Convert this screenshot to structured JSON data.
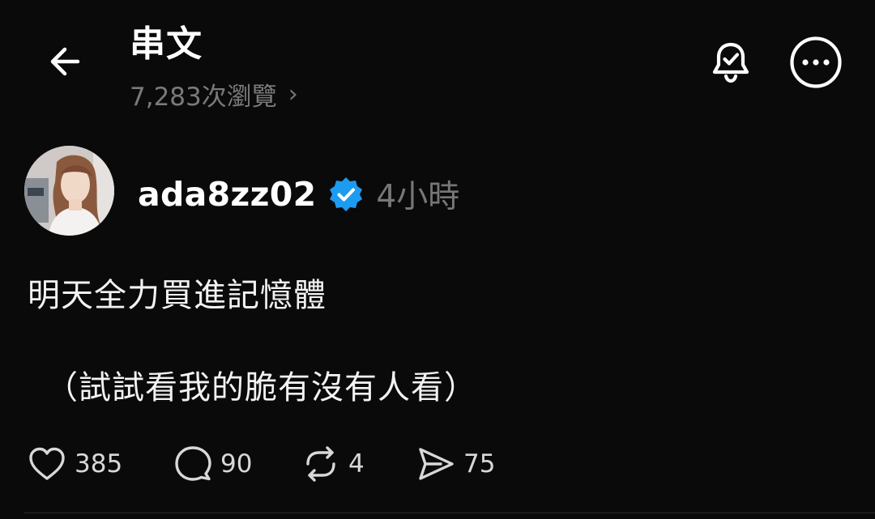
{
  "header": {
    "title": "串文",
    "views": "7,283次瀏覽",
    "views_chevron": "›"
  },
  "icons": {
    "back": "arrow-left-icon",
    "bell": "bell-check-icon",
    "more": "more-horizontal-icon"
  },
  "post": {
    "username": "ada8zz02",
    "verified": true,
    "time": "4小時",
    "text_line1": "明天全力買進記憶體",
    "text_line2": "（試試看我的脆有沒有人看）"
  },
  "actions": {
    "likes": "385",
    "replies": "90",
    "reposts": "4",
    "shares": "75"
  },
  "colors": {
    "background": "#0a0a0a",
    "verified_blue": "#1d9bf0",
    "muted": "#777777"
  }
}
